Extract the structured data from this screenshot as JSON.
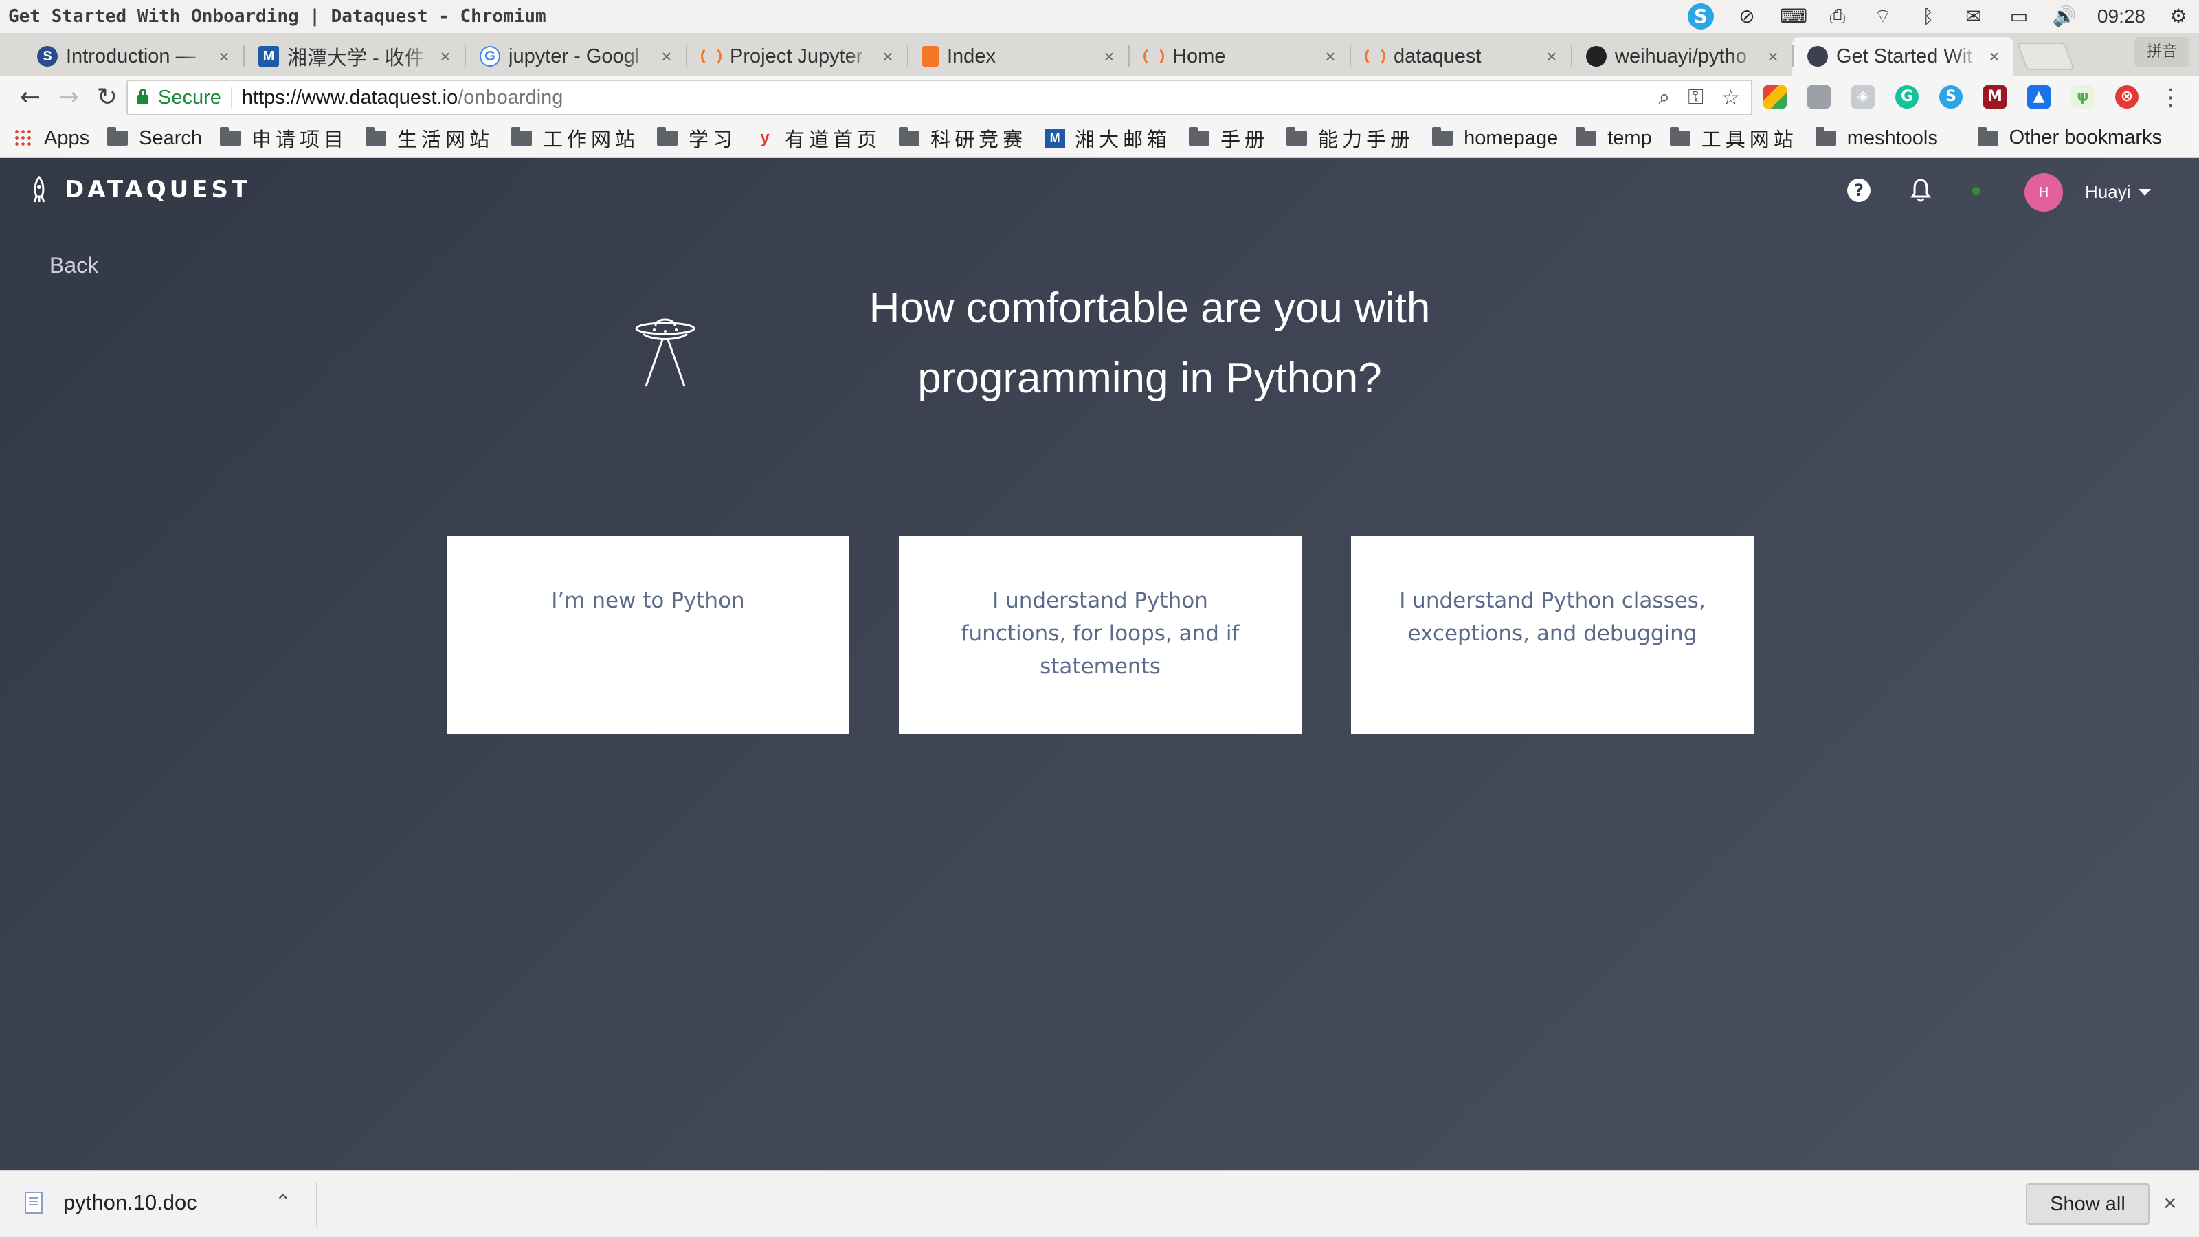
{
  "os": {
    "window_title": "Get Started With Onboarding | Dataquest - Chromium",
    "clock": "09:28",
    "input_method": "拼音"
  },
  "tabs": [
    {
      "title": "Introduction —",
      "fav_color": "#2b4c8c",
      "fav_glyph": "S"
    },
    {
      "title": "湘潭大学 - 收件",
      "fav_color": "#1f5aa8",
      "fav_glyph": "M"
    },
    {
      "title": "jupyter - Googl",
      "fav_color": "#4285f4",
      "fav_glyph": "G"
    },
    {
      "title": "Project Jupyter",
      "fav_color": "#f37726",
      "fav_glyph": "◌"
    },
    {
      "title": "Index",
      "fav_color": "#f37726",
      "fav_glyph": "▰"
    },
    {
      "title": "Home",
      "fav_color": "#f37726",
      "fav_glyph": "◌"
    },
    {
      "title": "dataquest",
      "fav_color": "#f37726",
      "fav_glyph": "◌"
    },
    {
      "title": "weihuayi/pytho",
      "fav_color": "#222222",
      "fav_glyph": "●"
    },
    {
      "title": "Get Started Wit",
      "fav_color": "#3b4150",
      "fav_glyph": "◉"
    }
  ],
  "toolbar": {
    "secure_label": "Secure",
    "url_host": "https://www.dataquest.io",
    "url_path": "/onboarding"
  },
  "bookmarks": {
    "apps": "Apps",
    "items": [
      "Search",
      "申请项目",
      "生活网站",
      "工作网站",
      "学习",
      "有道首页",
      "科研竞赛",
      "湘大邮箱",
      "手册",
      "能力手册",
      "homepage",
      "temp",
      "工具网站",
      "meshtools"
    ],
    "other": "Other bookmarks"
  },
  "page": {
    "brand": "DATAQUEST",
    "back": "Back",
    "avatar_initial": "H",
    "username": "Huayi",
    "question_line1": "How comfortable are you with",
    "question_line2": "programming in Python?",
    "options": [
      "I’m new to Python",
      "I understand Python functions, for loops, and if statements",
      "I understand Python classes, exceptions, and debugging"
    ]
  },
  "downloads": {
    "file": "python.10.doc",
    "show_all": "Show all"
  }
}
